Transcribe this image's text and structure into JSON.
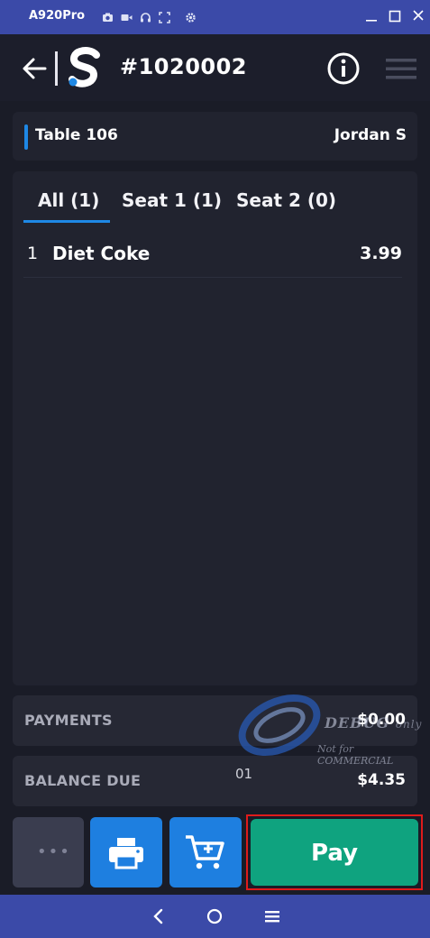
{
  "emulator": {
    "device_name": "A920Pro"
  },
  "header": {
    "order_number": "#1020002"
  },
  "table": {
    "name": "Table 106",
    "server": "Jordan S"
  },
  "tabs": [
    {
      "label": "All (1)",
      "selected": true
    },
    {
      "label": "Seat 1 (1)",
      "selected": false
    },
    {
      "label": "Seat 2 (0)",
      "selected": false
    }
  ],
  "items": [
    {
      "qty": "1",
      "name": "Diet Coke",
      "price": "3.99"
    }
  ],
  "summary": {
    "payments_label": "PAYMENTS",
    "payments_value": "$0.00",
    "balance_label": "BALANCE DUE",
    "balance_code": "01",
    "balance_value": "$4.35"
  },
  "watermark": {
    "line1": "DEBUG",
    "line1_suffix": "only",
    "line2": "Not for COMMERCIAL"
  },
  "actions": {
    "more_label": "•••",
    "pay_label": "Pay"
  },
  "colors": {
    "accent": "#1e88e5",
    "pay": "#0fa37f",
    "highlight": "#e01b1b",
    "system_bar": "#3b4aa8"
  }
}
